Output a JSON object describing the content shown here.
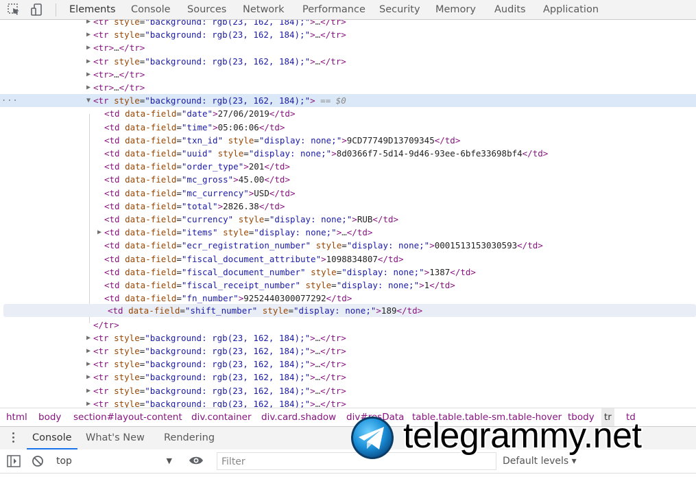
{
  "tabs": [
    "Elements",
    "Console",
    "Sources",
    "Network",
    "Performance",
    "Security",
    "Memory",
    "Audits",
    "Application"
  ],
  "active_tab": "Elements",
  "tree": {
    "collapsed_rows_top": [
      {
        "kind": "styled"
      },
      {
        "kind": "styled"
      },
      {
        "kind": "plain"
      },
      {
        "kind": "styled"
      },
      {
        "kind": "plain"
      },
      {
        "kind": "plain"
      }
    ],
    "tr_open": "<tr style=\"background: rgb(23, 162, 184);\">",
    "tr_style_value": "background: rgb(23, 162, 184);",
    "selected_marker": "== $0",
    "ellipsis": "...",
    "collapsed_plain_text": "<tr>…</tr>",
    "collapsed_styled_suffix": "…</tr>",
    "cells": [
      {
        "field": "date",
        "style": "",
        "value": "27/06/2019"
      },
      {
        "field": "time",
        "style": "",
        "value": "05:06:06"
      },
      {
        "field": "txn_id",
        "style": "display: none;",
        "value": "9CD77749D13709345"
      },
      {
        "field": "uuid",
        "style": "display: none;",
        "value": "8d0366f7-5d14-9d46-93ee-6bfe33698bf4"
      },
      {
        "field": "order_type",
        "style": "",
        "value": "201"
      },
      {
        "field": "mc_gross",
        "style": "",
        "value": "45.00"
      },
      {
        "field": "mc_currency",
        "style": "",
        "value": "USD"
      },
      {
        "field": "total",
        "style": "",
        "value": "2826.38"
      },
      {
        "field": "currency",
        "style": "display: none;",
        "value": "RUB"
      },
      {
        "field": "items",
        "style": "display: none;",
        "value": "…",
        "collapsed": true
      },
      {
        "field": "ecr_registration_number",
        "style": "display: none;",
        "value": "0001513153030593"
      },
      {
        "field": "fiscal_document_attribute",
        "style": "",
        "value": "1098834807"
      },
      {
        "field": "fiscal_document_number",
        "style": "display: none;",
        "value": "1387"
      },
      {
        "field": "fiscal_receipt_number",
        "style": "display: none;",
        "value": "1"
      },
      {
        "field": "fn_number",
        "style": "",
        "value": "9252440300077292"
      },
      {
        "field": "shift_number",
        "style": "display: none;",
        "value": "189"
      }
    ],
    "tr_close": "</tr>",
    "collapsed_rows_bottom": 6
  },
  "breadcrumbs": [
    "html",
    "body",
    "section#layout-content",
    "div.container",
    "div.card.shadow",
    "div#resData",
    "table.table.table-sm.table-hover",
    "tbody",
    "tr",
    "td"
  ],
  "breadcrumb_current": "tr",
  "drawer": {
    "tabs": [
      "Console",
      "What's New",
      "Rendering"
    ],
    "active": "Console",
    "context": "top",
    "filter_placeholder": "Filter",
    "levels": "Default levels ▾"
  },
  "watermark": "telegrammy.net",
  "colors": {
    "tag": "#881280",
    "attr_name": "#994500",
    "attr_value": "#1a1aa6",
    "accent": "#1a73e8",
    "selected_row": "#dbe8f7"
  }
}
